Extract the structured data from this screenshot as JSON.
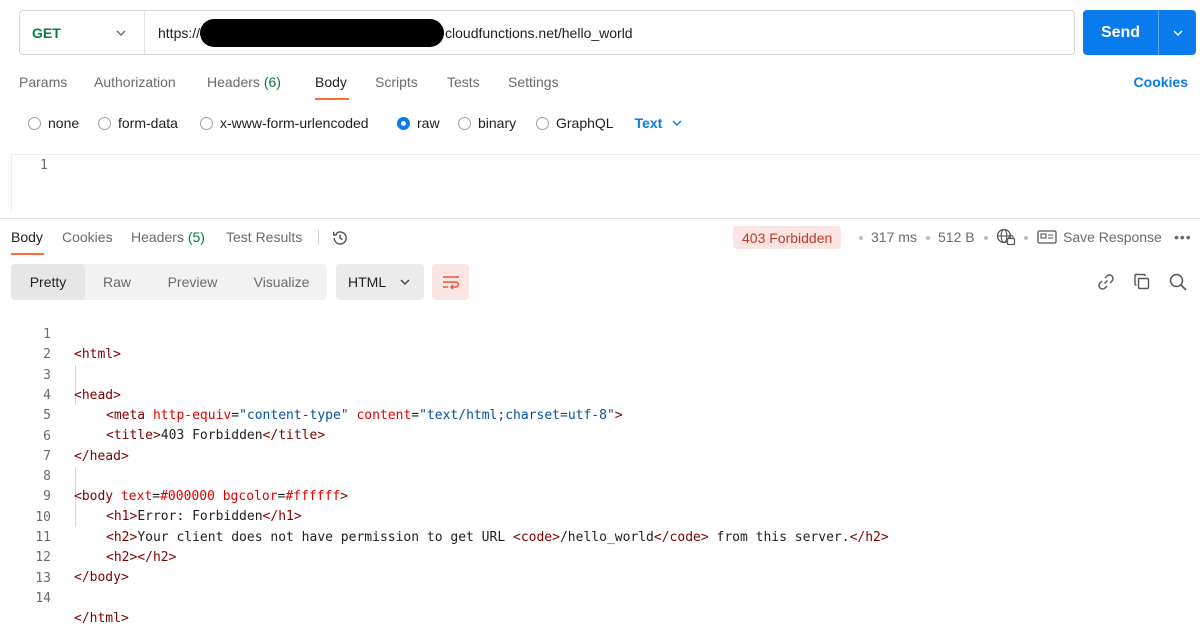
{
  "request": {
    "method": "GET",
    "url_prefix": "https://",
    "url_suffix": "cloudfunctions.net/hello_world",
    "send_label": "Send"
  },
  "request_tabs": [
    {
      "label": "Params"
    },
    {
      "label": "Authorization"
    },
    {
      "label": "Headers",
      "count": "(6)"
    },
    {
      "label": "Body",
      "active": true
    },
    {
      "label": "Scripts"
    },
    {
      "label": "Tests"
    },
    {
      "label": "Settings"
    }
  ],
  "cookies_label": "Cookies",
  "body_types": [
    "none",
    "form-data",
    "x-www-form-urlencoded",
    "raw",
    "binary",
    "GraphQL"
  ],
  "selected_body_type": "raw",
  "raw_format": "Text",
  "request_editor": {
    "line_numbers": [
      "1"
    ]
  },
  "response_tabs": [
    {
      "label": "Body",
      "active": true
    },
    {
      "label": "Cookies"
    },
    {
      "label": "Headers",
      "count": "(5)"
    },
    {
      "label": "Test Results"
    }
  ],
  "response_meta": {
    "status": "403 Forbidden",
    "time": "317 ms",
    "size": "512 B",
    "save_label": "Save Response",
    "more": "•••"
  },
  "view_modes": [
    "Pretty",
    "Raw",
    "Preview",
    "Visualize"
  ],
  "active_view": "Pretty",
  "response_format": "HTML",
  "code_lines": [
    {
      "n": "1",
      "code": "<html>"
    },
    {
      "n": "2",
      "code": ""
    },
    {
      "n": "3",
      "code": "<head>"
    },
    {
      "n": "4",
      "code": "    <meta http-equiv=\"content-type\" content=\"text/html;charset=utf-8\">"
    },
    {
      "n": "5",
      "code": "    <title>403 Forbidden</title>"
    },
    {
      "n": "6",
      "code": "</head>"
    },
    {
      "n": "7",
      "code": ""
    },
    {
      "n": "8",
      "code": "<body text=#000000 bgcolor=#ffffff>"
    },
    {
      "n": "9",
      "code": "    <h1>Error: Forbidden</h1>"
    },
    {
      "n": "10",
      "code": "    <h2>Your client does not have permission to get URL <code>/hello_world</code> from this server.</h2>"
    },
    {
      "n": "11",
      "code": "    <h2></h2>"
    },
    {
      "n": "12",
      "code": "</body>"
    },
    {
      "n": "13",
      "code": ""
    },
    {
      "n": "14",
      "code": "</html>"
    }
  ],
  "colors": {
    "accent": "#ff6c37",
    "primary": "#097bed",
    "method_get": "#0b7a3c",
    "error_bg": "#fbe5e3",
    "error_text": "#c0392b"
  },
  "icons": [
    "chevron-down-icon",
    "history-icon",
    "globe-lock-icon",
    "save-response-icon",
    "wrap-lines-icon",
    "link-icon",
    "copy-icon",
    "search-icon"
  ]
}
